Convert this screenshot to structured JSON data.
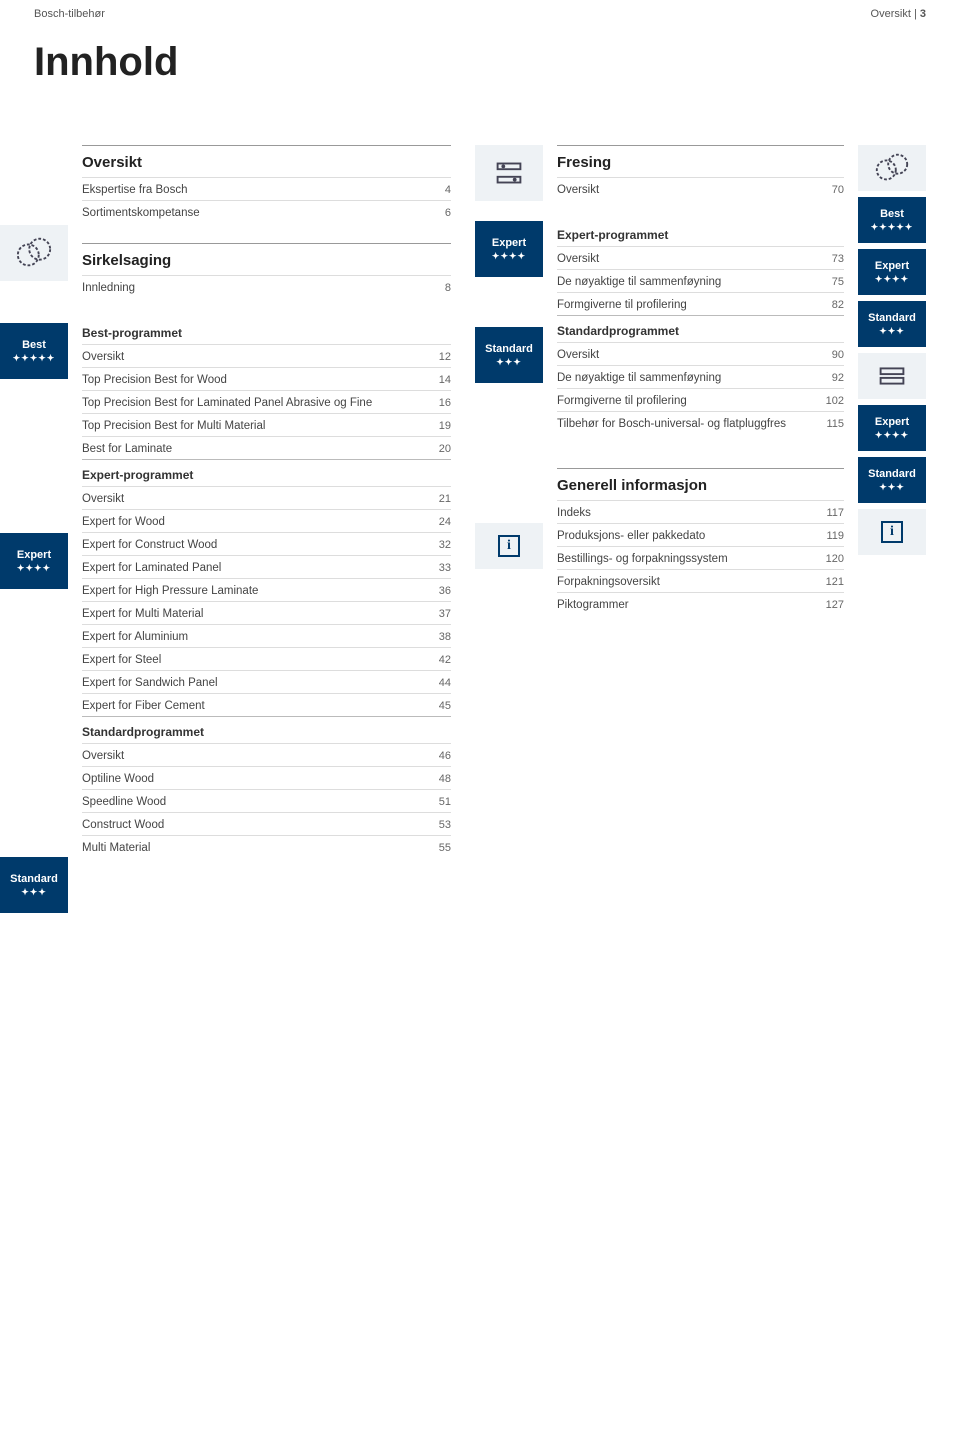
{
  "header": {
    "left": "Bosch-tilbehør",
    "right_label": "Oversikt",
    "right_page": "3"
  },
  "title": "Innhold",
  "left": {
    "intro": {
      "heading": "Oversikt",
      "rows": [
        {
          "label": "Ekspertise fra Bosch",
          "pg": "4"
        },
        {
          "label": "Sortimentskompetanse",
          "pg": "6"
        }
      ]
    },
    "sirkelsaging": {
      "heading": "Sirkelsaging",
      "rows": [
        {
          "label": "Innledning",
          "pg": "8"
        }
      ]
    },
    "best": {
      "badge": "Best",
      "stars": "✦✦✦✦✦",
      "heading": "Best-programmet",
      "rows": [
        {
          "label": "Oversikt",
          "pg": "12"
        },
        {
          "label": "Top Precision Best for Wood",
          "pg": "14"
        },
        {
          "label": "Top Precision Best for Laminated Panel Abrasive og Fine",
          "pg": "16"
        },
        {
          "label": "Top Precision Best for Multi Material",
          "pg": "19"
        },
        {
          "label": "Best for Laminate",
          "pg": "20"
        }
      ]
    },
    "expert": {
      "badge": "Expert",
      "stars": "✦✦✦✦",
      "heading": "Expert-programmet",
      "rows": [
        {
          "label": "Oversikt",
          "pg": "21"
        },
        {
          "label": "Expert for Wood",
          "pg": "24"
        },
        {
          "label": "Expert for Construct Wood",
          "pg": "32"
        },
        {
          "label": "Expert for Laminated Panel",
          "pg": "33"
        },
        {
          "label": "Expert for High Pressure Laminate",
          "pg": "36"
        },
        {
          "label": "Expert for Multi Material",
          "pg": "37"
        },
        {
          "label": "Expert for Aluminium",
          "pg": "38"
        },
        {
          "label": "Expert for Steel",
          "pg": "42"
        },
        {
          "label": "Expert for Sandwich Panel",
          "pg": "44"
        },
        {
          "label": "Expert for Fiber Cement",
          "pg": "45"
        }
      ]
    },
    "standard": {
      "badge": "Standard",
      "stars": "✦✦✦",
      "heading": "Standardprogrammet",
      "rows": [
        {
          "label": "Oversikt",
          "pg": "46"
        },
        {
          "label": "Optiline Wood",
          "pg": "48"
        },
        {
          "label": "Speedline Wood",
          "pg": "51"
        },
        {
          "label": "Construct Wood",
          "pg": "53"
        },
        {
          "label": "Multi Material",
          "pg": "55"
        }
      ]
    }
  },
  "right": {
    "fresing": {
      "heading": "Fresing",
      "rows": [
        {
          "label": "Oversikt",
          "pg": "70"
        }
      ]
    },
    "expert": {
      "badge": "Expert",
      "stars": "✦✦✦✦",
      "heading": "Expert-programmet",
      "rows": [
        {
          "label": "Oversikt",
          "pg": "73"
        },
        {
          "label": "De nøyaktige til sammenføyning",
          "pg": "75"
        },
        {
          "label": "Formgiverne til profilering",
          "pg": "82"
        }
      ]
    },
    "standard": {
      "badge": "Standard",
      "stars": "✦✦✦",
      "heading": "Standardprogrammet",
      "rows": [
        {
          "label": "Oversikt",
          "pg": "90"
        },
        {
          "label": "De nøyaktige til sammenføyning",
          "pg": "92"
        },
        {
          "label": "Formgiverne til profilering",
          "pg": "102"
        },
        {
          "label": "Tilbehør for Bosch-universal- og flatpluggfres",
          "pg": "115"
        }
      ]
    },
    "info": {
      "heading": "Generell informasjon",
      "rows": [
        {
          "label": "Indeks",
          "pg": "117"
        },
        {
          "label": "Produksjons- eller pakkedato",
          "pg": "119"
        },
        {
          "label": "Bestillings- og forpakningssystem",
          "pg": "120"
        },
        {
          "label": "Forpakningsoversikt",
          "pg": "121"
        },
        {
          "label": "Piktogrammer",
          "pg": "127"
        }
      ]
    },
    "rail": {
      "best": "Best",
      "best_stars": "✦✦✦✦✦",
      "expert": "Expert",
      "expert_stars": "✦✦✦✦",
      "standard": "Standard",
      "standard_stars": "✦✦✦",
      "expert2": "Expert",
      "expert2_stars": "✦✦✦✦",
      "standard2": "Standard",
      "standard2_stars": "✦✦✦"
    }
  }
}
